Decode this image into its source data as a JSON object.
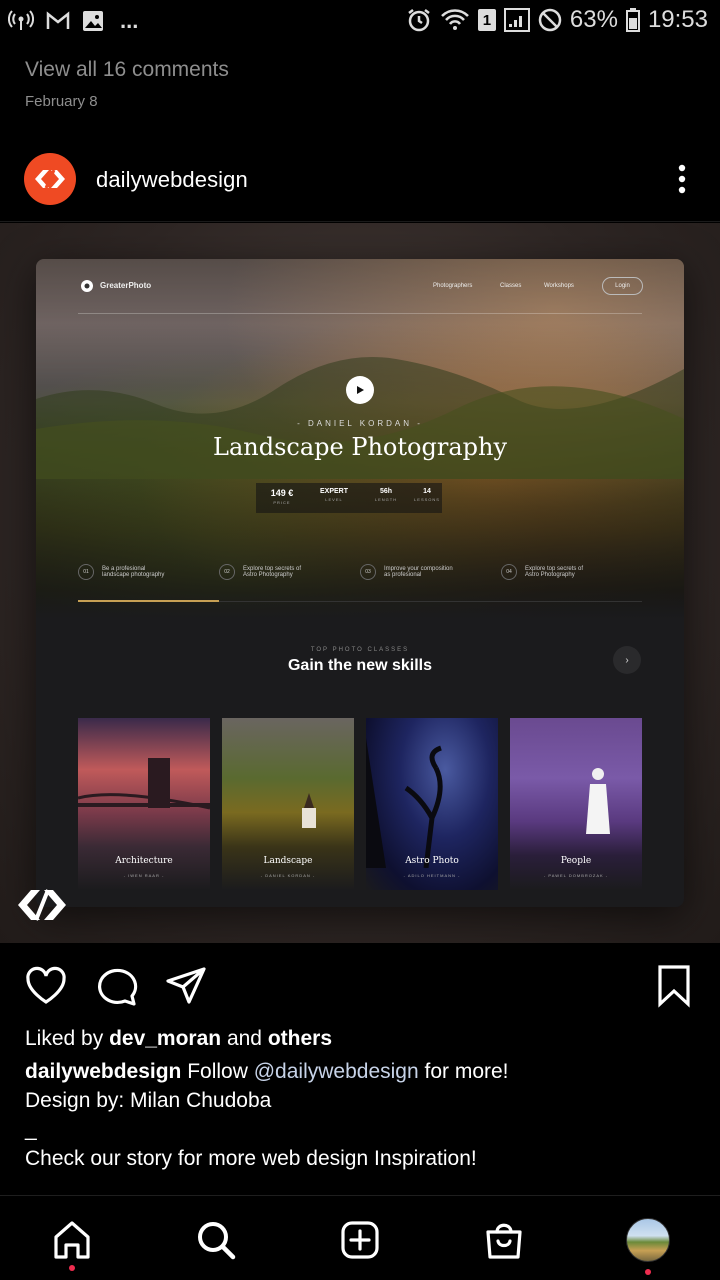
{
  "status_bar": {
    "battery": "63%",
    "time": "19:53",
    "sim_badge": "1",
    "more": "..."
  },
  "previous_post": {
    "view_comments": "View all 16 comments",
    "date": "February 8"
  },
  "post": {
    "username": "dailywebdesign",
    "liked_by_prefix": "Liked by ",
    "liked_by_user": "dev_moran",
    "liked_by_mid": " and ",
    "liked_by_others": "others",
    "caption_user": "dailywebdesign",
    "caption_text1": " Follow ",
    "caption_mention": "@dailywebdesign",
    "caption_text2": " for more!",
    "caption_line2": "Design by: Milan Chudoba",
    "caption_line3": "_",
    "caption_line4": "Check our story for more web design Inspiration!"
  },
  "site": {
    "brand": "GreaterPhoto",
    "nav": [
      "Photographers",
      "Classes",
      "Workshops"
    ],
    "login": "Login",
    "author": "- DANIEL KORDAN -",
    "title": "Landscape Photography",
    "stats": [
      {
        "v": "149 €",
        "l": "PRICE"
      },
      {
        "v": "EXPERT",
        "l": "LEVEL"
      },
      {
        "v": "56h",
        "l": "LENGTH"
      },
      {
        "v": "14",
        "l": "LESSONS"
      }
    ],
    "features": [
      {
        "n": "01",
        "t1": "Be a profesional",
        "t2": "landscape photography"
      },
      {
        "n": "02",
        "t1": "Explore top secrets of",
        "t2": "Astro Photography"
      },
      {
        "n": "03",
        "t1": "Improve your composition",
        "t2": "as profesional"
      },
      {
        "n": "04",
        "t1": "Explore top secrets of",
        "t2": "Astro Photography"
      }
    ],
    "section_eyebrow": "TOP PHOTO CLASSES",
    "section_title": "Gain the new skills",
    "cards": [
      {
        "title": "Architecture",
        "sub": "- IWEN RAAR -"
      },
      {
        "title": "Landscape",
        "sub": "- DANIEL KORDAN -"
      },
      {
        "title": "Astro Photo",
        "sub": "- ADILO HEITMANN -"
      },
      {
        "title": "People",
        "sub": "- PAWEL DOMBROZAK -"
      }
    ]
  },
  "colors": {
    "accent": "#ef4a23",
    "notification": "#ef2d4f",
    "link": "#c7d3e8"
  }
}
